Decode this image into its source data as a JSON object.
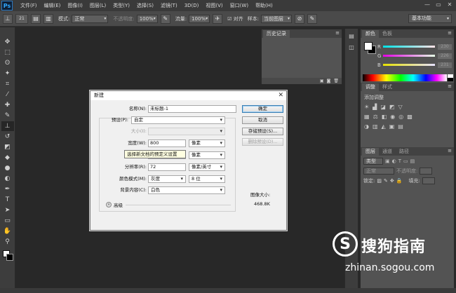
{
  "app": {
    "logo": "Ps"
  },
  "menu": [
    "文件(F)",
    "编辑(E)",
    "图像(I)",
    "图层(L)",
    "类型(Y)",
    "选择(S)",
    "滤镜(T)",
    "3D(D)",
    "视图(V)",
    "窗口(W)",
    "帮助(H)"
  ],
  "window_controls": {
    "minimize": "—",
    "restore": "▭",
    "close": "✕"
  },
  "options_bar": {
    "brush_size": "21",
    "mode_label": "模式:",
    "mode_value": "正常",
    "opacity_label": "不透明度:",
    "opacity_value": "100%",
    "flow_label": "流量:",
    "flow_value": "100%",
    "align_label": "对齐",
    "sample_label": "样本:",
    "sample_value": "当前图层",
    "workspace": "基本功能"
  },
  "panels": {
    "history_tab": "历史记录",
    "color_tab": "颜色",
    "swatches_tab": "色板",
    "adjustments_tab": "调整",
    "styles_tab": "样式",
    "adjustments_title": "添加调整",
    "layers_tab": "图层",
    "channels_tab": "通道",
    "paths_tab": "路径",
    "kind_label": "类型",
    "blend_mode": "正常",
    "opacity_label": "不透明度:",
    "lock_label": "锁定:",
    "fill_label": "填充:",
    "color": {
      "r_label": "R",
      "r_value": "230",
      "g_label": "G",
      "g_value": "226",
      "b_label": "B",
      "b_value": "231"
    }
  },
  "dialog": {
    "title": "新建",
    "close": "✕",
    "name_label": "名称(N):",
    "name_value": "未标题-1",
    "preset_label": "预设(P):",
    "preset_value": "自定",
    "size_label": "大小(I):",
    "width_label": "宽度(W):",
    "width_value": "800",
    "width_unit": "像素",
    "height_unit": "像素",
    "tooltip": "选择新文档的预定义设置",
    "resolution_label": "分辨率(R):",
    "resolution_value": "72",
    "resolution_unit": "像素/英寸",
    "color_mode_label": "颜色模式(M):",
    "color_mode_value": "灰度",
    "bit_depth": "8 位",
    "bg_label": "背景内容(C):",
    "bg_value": "白色",
    "advanced_label": "高级",
    "ok_button": "确定",
    "cancel_button": "取消",
    "save_preset_button": "存储预设(S)...",
    "delete_preset_button": "删除预设(D)...",
    "image_size_label": "图像大小:",
    "image_size_value": "468.8K"
  },
  "watermark": {
    "text": "搜狗指南",
    "url": "zhinan.sogou.com",
    "logo": "S"
  }
}
